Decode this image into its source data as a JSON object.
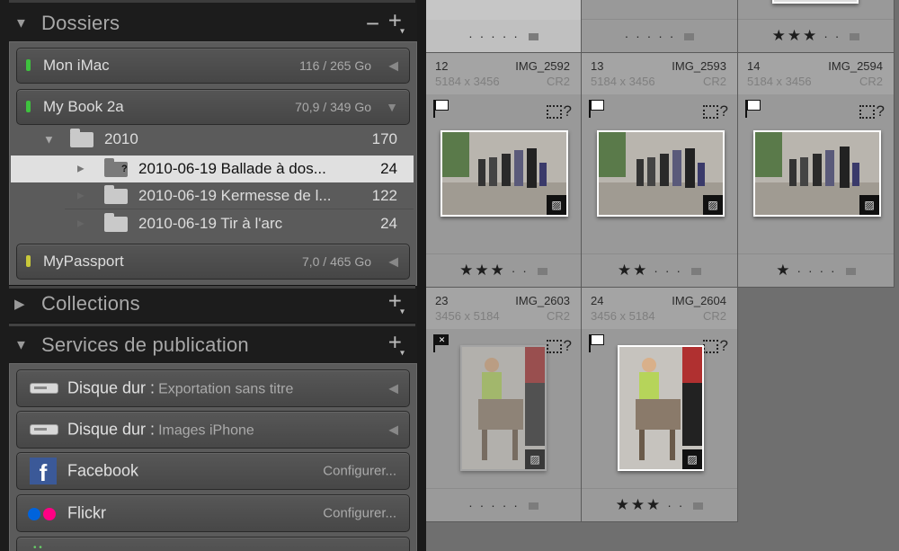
{
  "folders_panel": {
    "title": "Dossiers",
    "minus": "−",
    "plus": "+",
    "volumes": [
      {
        "name": "Mon iMac",
        "size": "116 / 265 Go",
        "led": "#3ec23e"
      },
      {
        "name": "My Book 2a",
        "size": "70,9 / 349 Go",
        "led": "#3ec23e"
      },
      {
        "name": "MyPassport",
        "size": "7,0 / 465 Go",
        "led": "#c8c83a"
      }
    ],
    "tree": {
      "parent": {
        "name": "2010",
        "count": "170"
      },
      "children": [
        {
          "name": "2010-06-19 Ballade à dos...",
          "count": "24",
          "selected": true
        },
        {
          "name": "2010-06-19 Kermesse de l...",
          "count": "122"
        },
        {
          "name": "2010-06-19 Tir à l'arc",
          "count": "24"
        }
      ]
    }
  },
  "collections_panel": {
    "title": "Collections",
    "plus": "+"
  },
  "publish_panel": {
    "title": "Services de publication",
    "plus": "+",
    "services": [
      {
        "name": "Disque dur",
        "sub": "Exportation sans titre",
        "icon": "hard-drive-icon"
      },
      {
        "name": "Disque dur",
        "sub": "Images iPhone",
        "icon": "hard-drive-icon"
      },
      {
        "name": "Facebook",
        "action": "Configurer...",
        "icon": "facebook-icon"
      },
      {
        "name": "Flickr",
        "action": "Configurer...",
        "icon": "flickr-icon"
      }
    ]
  },
  "grid": {
    "top_row": [
      {
        "rating": 0
      },
      {
        "rating": 0
      },
      {
        "rating": 3
      }
    ],
    "cells": [
      {
        "index": "12",
        "name": "IMG_2592",
        "dims": "5184 x 3456",
        "ext": "CR2",
        "rating": 3,
        "flag": "pick",
        "orientation": "landscape"
      },
      {
        "index": "13",
        "name": "IMG_2593",
        "dims": "5184 x 3456",
        "ext": "CR2",
        "rating": 2,
        "flag": "pick",
        "orientation": "landscape"
      },
      {
        "index": "14",
        "name": "IMG_2594",
        "dims": "5184 x 3456",
        "ext": "CR2",
        "rating": 1,
        "flag": "pick",
        "orientation": "landscape"
      },
      {
        "index": "23",
        "name": "IMG_2603",
        "dims": "3456 x 5184",
        "ext": "CR2",
        "rating": 0,
        "flag": "reject",
        "orientation": "portrait"
      },
      {
        "index": "24",
        "name": "IMG_2604",
        "dims": "3456 x 5184",
        "ext": "CR2",
        "rating": 3,
        "flag": "pick",
        "orientation": "portrait"
      }
    ]
  }
}
